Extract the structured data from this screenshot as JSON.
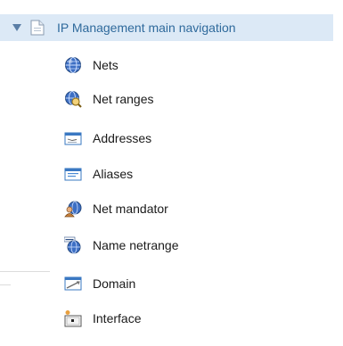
{
  "tree": {
    "root": {
      "label": "IP Management main navigation",
      "expanded": true,
      "icon": "page-icon"
    },
    "items": [
      {
        "label": "Nets",
        "icon": "globe-icon"
      },
      {
        "label": "Net ranges",
        "icon": "globe-search-icon"
      },
      {
        "label": "Addresses",
        "icon": "address-card-icon"
      },
      {
        "label": "Aliases",
        "icon": "alias-card-icon"
      },
      {
        "label": "Net mandator",
        "icon": "globe-user-icon"
      },
      {
        "label": "Name netrange",
        "icon": "named-globe-icon"
      },
      {
        "label": "Domain",
        "icon": "domain-window-icon"
      },
      {
        "label": "Interface",
        "icon": "interface-icon"
      }
    ]
  },
  "colors": {
    "root_highlight": "#dce9f6",
    "root_text": "#2f6a9c",
    "item_text": "#1a1a1a"
  }
}
